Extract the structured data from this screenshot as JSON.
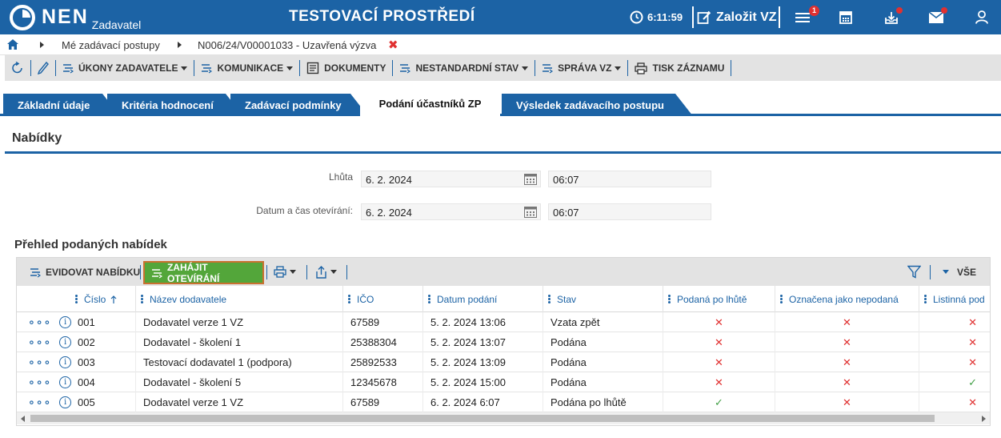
{
  "header": {
    "logo_text": "NEN",
    "logo_sub": "Zadavatel",
    "environment_title": "TESTOVACÍ PROSTŘEDÍ",
    "session_time": "6:11:59",
    "create_label": "Založit VZ",
    "menu_badge_count": "1",
    "icons": [
      "clock-icon",
      "edit-icon",
      "menu-icon",
      "calculator-icon",
      "inbox-icon",
      "mail-icon",
      "user-icon"
    ]
  },
  "breadcrumb": {
    "item1": "Mé zadávací postupy",
    "item2": "N006/24/V00001033 - Uzavřená výzva"
  },
  "actions": {
    "ukony": "ÚKONY ZADAVATELE",
    "komunikace": "KOMUNIKACE",
    "dokumenty": "DOKUMENTY",
    "nestandardni": "NESTANDARDNÍ STAV",
    "sprava": "SPRÁVA VZ",
    "tisk": "TISK ZÁZNAMU"
  },
  "tabs": [
    {
      "label": "Základní údaje"
    },
    {
      "label": "Kritéria hodnocení"
    },
    {
      "label": "Zadávací podmínky"
    },
    {
      "label": "Podání účastníků ZP"
    },
    {
      "label": "Výsledek zadávacího postupu"
    }
  ],
  "section": {
    "title": "Nabídky",
    "lhuta_label": "Lhůta",
    "lhuta_date": "6. 2. 2024",
    "lhuta_time": "06:07",
    "otevirani_label": "Datum a čas otevírání:",
    "otevirani_date": "6. 2. 2024",
    "otevirani_time": "06:07"
  },
  "overview": {
    "title": "Přehled podaných nabídek",
    "evidovat": "EVIDOVAT NABÍDKU",
    "zahajit": "ZAHÁJIT OTEVÍRÁNÍ",
    "vse": "VŠE",
    "columns": [
      "Číslo",
      "Název dodavatele",
      "IČO",
      "Datum podání",
      "Stav",
      "Podaná po lhůtě",
      "Označena jako nepodaná",
      "Listinná pod"
    ],
    "rows": [
      {
        "cislo": "001",
        "nazev": "Dodavatel verze 1 VZ",
        "ico": "67589",
        "datum": "5. 2. 2024 13:06",
        "stav": "Vzata zpět",
        "po_lhute": "✕",
        "nepodana": "✕",
        "listinna": "✕"
      },
      {
        "cislo": "002",
        "nazev": "Dodavatel - školení 1",
        "ico": "25388304",
        "datum": "5. 2. 2024 13:07",
        "stav": "Podána",
        "po_lhute": "✕",
        "nepodana": "✕",
        "listinna": "✕"
      },
      {
        "cislo": "003",
        "nazev": "Testovací dodavatel 1 (podpora)",
        "ico": "25892533",
        "datum": "5. 2. 2024 13:09",
        "stav": "Podána",
        "po_lhute": "✕",
        "nepodana": "✕",
        "listinna": "✕"
      },
      {
        "cislo": "004",
        "nazev": "Dodavatel - školení 5",
        "ico": "12345678",
        "datum": "5. 2. 2024 15:00",
        "stav": "Podána",
        "po_lhute": "✕",
        "nepodana": "✕",
        "listinna": "✓"
      },
      {
        "cislo": "005",
        "nazev": "Dodavatel verze 1 VZ",
        "ico": "67589",
        "datum": "6. 2. 2024 6:07",
        "stav": "Podána po lhůtě",
        "po_lhute": "✓",
        "nepodana": "✕",
        "listinna": "✕"
      }
    ]
  },
  "colors": {
    "primary": "#1c63a5",
    "accent_green": "#53a63a",
    "danger": "#e03131",
    "success": "#43a047"
  }
}
